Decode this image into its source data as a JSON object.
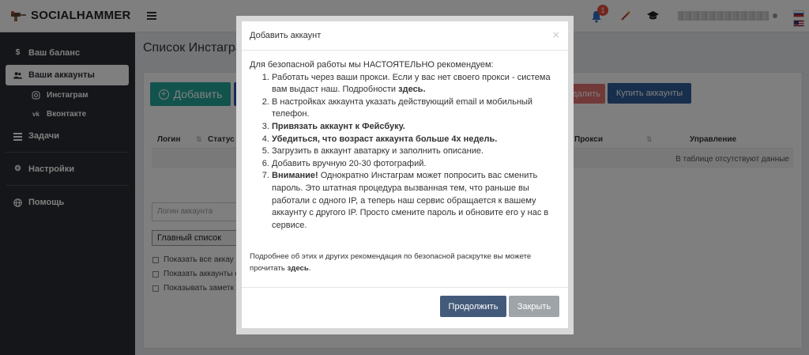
{
  "app": {
    "name": "SOCIALHAMMER"
  },
  "topbar": {
    "notification_count": "1"
  },
  "sidebar": {
    "items": [
      {
        "label": "Ваш баланс",
        "icon": "dollar-icon"
      },
      {
        "label": "Ваши аккаунты",
        "icon": "users-icon"
      },
      {
        "label": "Задачи",
        "icon": "tasks-icon"
      },
      {
        "label": "Настройки",
        "icon": "gear-icon"
      },
      {
        "label": "Помощь",
        "icon": "globe-icon"
      }
    ],
    "subitems": [
      {
        "label": "Инстаграм",
        "icon": "instagram-icon"
      },
      {
        "label": "Вконтакте",
        "icon": "vk-icon"
      }
    ]
  },
  "main": {
    "page_title": "Список Инстаграм",
    "add_button": "Добавить",
    "delete_button": "Удалить",
    "buy_button": "Купить аккаунты",
    "table": {
      "headers": [
        "Логин",
        "Статус",
        "Прокси",
        "Управление"
      ],
      "empty_text": "В таблице отсутствуют данные"
    },
    "filter_placeholder": "Логин аккаунта",
    "list_select": "Главный список",
    "checkboxes": [
      "Показать все аккау",
      "Показать аккаунты с",
      "Показывать заметк"
    ]
  },
  "modal": {
    "title": "Добавить аккаунт",
    "close_symbol": "×",
    "intro": "Для безопасной работы мы НАСТОЯТЕЛЬНО рекомендуем:",
    "step1_text": "Работать через ваши прокси. Если у вас нет своего прокси - система вам выдаст наш. Подробности ",
    "step1_link": "здесь.",
    "step2": "В настройках аккаунта указать действующий email и мобильный телефон.",
    "step3": "Привязать аккаунт к Фейсбуку.",
    "step4": "Убедиться, что возраст аккаунта больше 4х недель.",
    "step5": "Загрузить в аккаунт аватарку и заполнить описание.",
    "step6": "Добавить вручную 20-30 фотографий.",
    "step7_bold": "Внимание!",
    "step7_text": " Однократно Инстаграм может попросить вас сменить пароль. Это штатная процедура вызванная тем, что раньше вы работали с одного IP, а теперь наш сервис обращается к вашему аккаунту с другого IP. Просто смените пароль и обновите его у нас в сервисе.",
    "note_text": "Подробнее об этих и других рекомендация по безопасной раскрутке вы можете прочитать ",
    "note_link": "здесь",
    "note_end": ".",
    "continue_button": "Продолжить",
    "close_button": "Закрыть"
  }
}
